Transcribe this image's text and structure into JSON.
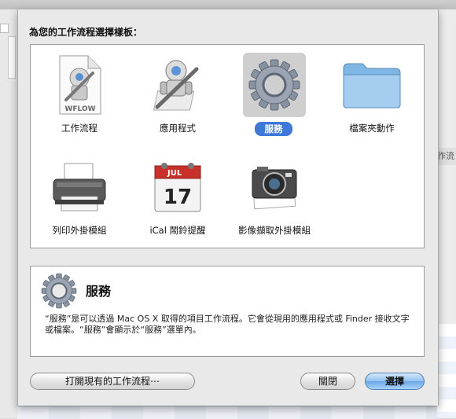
{
  "background": {
    "right_window_fragment": "作流"
  },
  "sheet": {
    "prompt": "為您的工作流程選擇樣板：",
    "templates": [
      {
        "label": "工作流程",
        "icon": "workflow-document-icon"
      },
      {
        "label": "應用程式",
        "icon": "automator-robot-icon"
      },
      {
        "label": "服務",
        "icon": "gear-icon",
        "selected": true
      },
      {
        "label": "檔案夾動作",
        "icon": "folder-icon"
      },
      {
        "label": "列印外掛模組",
        "icon": "printer-icon"
      },
      {
        "label": "iCal 鬧鈴提醒",
        "icon": "calendar-icon",
        "calendar_month": "JUL",
        "calendar_day": "17"
      },
      {
        "label": "影像擷取外掛模組",
        "icon": "camera-icon"
      }
    ],
    "workflow_doc_badge": "WFLOW",
    "description": {
      "title": "服務",
      "icon": "gear-icon",
      "text": "“服務”是可以透過 Mac OS X 取得的項目工作流程。它會從現用的應用程式或 Finder 接收文字或檔案。“服務”會顯示於“服務”選單內。"
    },
    "buttons": {
      "open_existing": "打開現有的工作流程⋯",
      "close": "關閉",
      "choose": "選擇"
    }
  }
}
